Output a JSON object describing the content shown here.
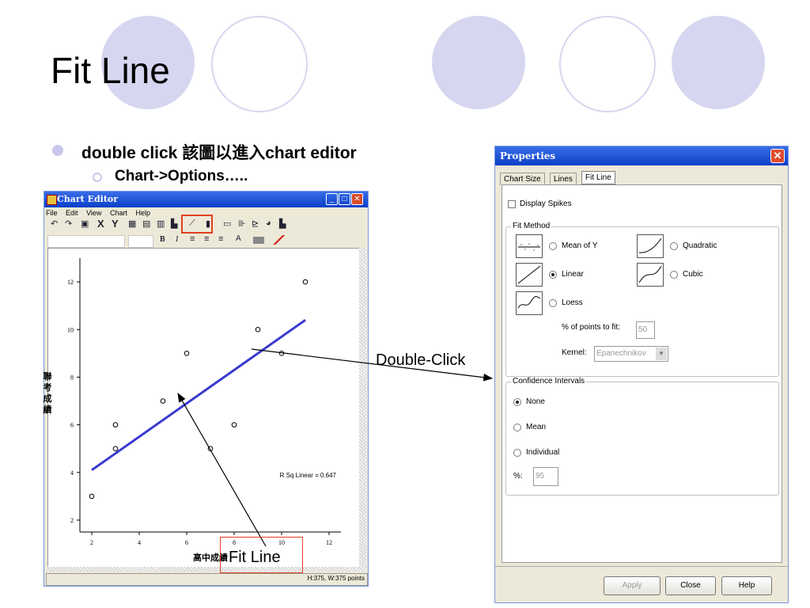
{
  "slide": {
    "title": "Fit Line",
    "bullet1": "double click 該圖以進入chart editor",
    "bullet2": "Chart->Options….."
  },
  "annotations": {
    "double_click": "Double-Click",
    "fit_line": "Fit Line"
  },
  "chart_editor": {
    "title": "Chart Editor",
    "menu": [
      "File",
      "Edit",
      "View",
      "Chart",
      "Help"
    ],
    "toolbar_x": "X",
    "toolbar_y": "Y",
    "toolbar_bold": "B",
    "toolbar_italic": "I",
    "toolbar_text": "A",
    "status": "H:375, W:375 points"
  },
  "chart_data": {
    "type": "scatter",
    "xlabel": "高中成績",
    "ylabel": "聯考成績",
    "xlim": [
      1.5,
      12.5
    ],
    "ylim": [
      1.5,
      13
    ],
    "xticks": [
      2,
      4,
      6,
      8,
      10,
      12
    ],
    "yticks": [
      2,
      4,
      6,
      8,
      10,
      12
    ],
    "points": [
      [
        2,
        3
      ],
      [
        3,
        5
      ],
      [
        3,
        6
      ],
      [
        5,
        7
      ],
      [
        6,
        9
      ],
      [
        7,
        5
      ],
      [
        8,
        6
      ],
      [
        9,
        10
      ],
      [
        10,
        9
      ],
      [
        11,
        12
      ]
    ],
    "fit_line": {
      "x": [
        2,
        11
      ],
      "y": [
        4.1,
        10.4
      ]
    },
    "annotation": "R Sq Linear = 0.647"
  },
  "properties": {
    "title": "Properties",
    "close_glyph": "✕",
    "tabs": [
      "Chart Size",
      "Lines",
      "Fit Line"
    ],
    "display_spikes": "Display Spikes",
    "fit_method": {
      "legend": "Fit Method",
      "mean": "Mean of Y",
      "quadratic": "Quadratic",
      "linear": "Linear",
      "cubic": "Cubic",
      "loess": "Loess",
      "points_label": "% of points to fit:",
      "points_value": "50",
      "kernel_label": "Kernel:",
      "kernel_value": "Epanechnikov",
      "selected": "Linear"
    },
    "confidence": {
      "legend": "Confidence Intervals",
      "none": "None",
      "mean": "Mean",
      "individual": "Individual",
      "pct_label": "%:",
      "pct_value": "95",
      "selected": "None"
    },
    "buttons": {
      "apply": "Apply",
      "close": "Close",
      "help": "Help"
    }
  },
  "colors": {
    "circle": "#d6d6f0",
    "fit_line": "#3a3ad0",
    "highlight": "#e04020",
    "titlebar": "#0a3fc8"
  }
}
